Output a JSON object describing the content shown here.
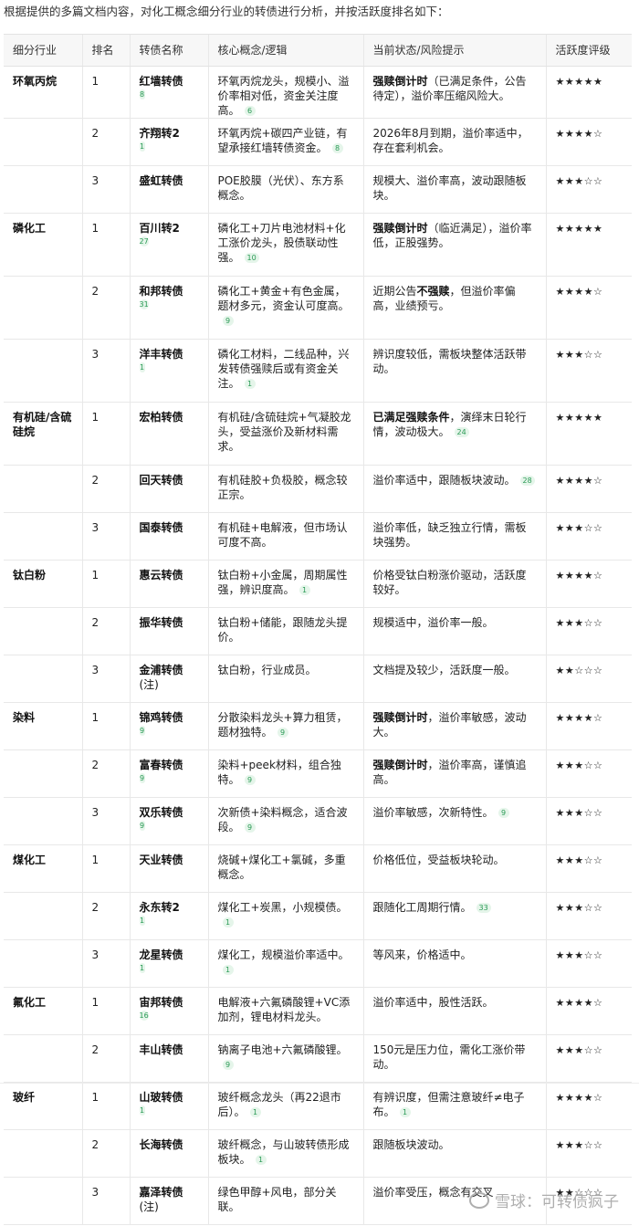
{
  "intro": "根据提供的多篇文档内容，对化工概念细分行业的转债进行分析，并按活跃度排名如下：",
  "headers": [
    "细分行业",
    "排名",
    "转债名称",
    "核心概念/逻辑",
    "当前状态/风险提示",
    "活跃度评级"
  ],
  "rows": [
    {
      "industry": "环氧丙烷",
      "rank": "1",
      "bond": "红墙转债",
      "bond_badge": "8",
      "bond_note": "",
      "concept": "环氧丙烷龙头，规模小、溢价率相对低，资金关注度高。",
      "concept_badge": "6",
      "status_strong": "强赎倒计时",
      "status": "（已满足条件，公告待定），溢价率压缩风险大。",
      "status_strong2": "",
      "status_tail": "",
      "status_badge": "",
      "rating": "★★★★★"
    },
    {
      "industry": "",
      "rank": "2",
      "bond": "齐翔转2",
      "bond_badge": "1",
      "bond_note": "",
      "concept": "环氧丙烷+碳四产业链，有望承接红墙转债资金。",
      "concept_badge": "8",
      "status_strong": "",
      "status": "2026年8月到期，溢价率适中，存在套利机会。",
      "status_strong2": "",
      "status_tail": "",
      "status_badge": "",
      "rating": "★★★★☆"
    },
    {
      "industry": "",
      "rank": "3",
      "bond": "盛虹转债",
      "bond_badge": "",
      "bond_note": "",
      "concept": "POE胶膜（光伏）、东方系概念。",
      "concept_badge": "",
      "status_strong": "",
      "status": "规模大、溢价率高，波动跟随板块。",
      "status_strong2": "",
      "status_tail": "",
      "status_badge": "",
      "rating": "★★★☆☆"
    },
    {
      "industry": "磷化工",
      "rank": "1",
      "bond": "百川转2",
      "bond_badge": "27",
      "bond_note": "",
      "concept": "磷化工+刀片电池材料+化工涨价龙头，股债联动性强。",
      "concept_badge": "10",
      "status_strong": "强赎倒计时",
      "status": "（临近满足），溢价率低，正股强势。",
      "status_strong2": "",
      "status_tail": "",
      "status_badge": "",
      "rating": "★★★★★",
      "tall": true
    },
    {
      "industry": "",
      "rank": "2",
      "bond": "和邦转债",
      "bond_badge": "31",
      "bond_note": "",
      "concept": "磷化工+黄金+有色金属，题材多元，资金认可度高。",
      "concept_badge": "9",
      "status_strong": "",
      "status": "近期公告",
      "status_strong2": "不强赎",
      "status_tail": "，但溢价率偏高，业绩预亏。",
      "status_badge": "",
      "rating": "★★★★☆",
      "tall": true
    },
    {
      "industry": "",
      "rank": "3",
      "bond": "洋丰转债",
      "bond_badge": "1",
      "bond_note": "",
      "concept": "磷化工材料，二线品种，兴发转债强赎后或有资金关注。",
      "concept_badge": "1",
      "status_strong": "",
      "status": "辨识度较低，需板块整体活跃带动。",
      "status_strong2": "",
      "status_tail": "",
      "status_badge": "",
      "rating": "★★★☆☆",
      "tall": true
    },
    {
      "industry": "有机硅/含硫硅烷",
      "rank": "1",
      "bond": "宏柏转债",
      "bond_badge": "",
      "bond_note": "",
      "concept": "有机硅/含硫硅烷+气凝胶龙头，受益涨价及新材料需求。",
      "concept_badge": "",
      "status_strong": "已满足强赎条件",
      "status": "，演绎末日轮行情，波动极大。",
      "status_strong2": "",
      "status_tail": "",
      "status_badge": "24",
      "rating": "★★★★★",
      "tall": true
    },
    {
      "industry": "",
      "rank": "2",
      "bond": "回天转债",
      "bond_badge": "",
      "bond_note": "",
      "concept": "有机硅胶+负极胶，概念较正宗。",
      "concept_badge": "",
      "status_strong": "",
      "status": "溢价率适中，跟随板块波动。",
      "status_strong2": "",
      "status_tail": "",
      "status_badge": "28",
      "rating": "★★★★☆"
    },
    {
      "industry": "",
      "rank": "3",
      "bond": "国泰转债",
      "bond_badge": "",
      "bond_note": "",
      "concept": "有机硅+电解液，但市场认可度不高。",
      "concept_badge": "",
      "status_strong": "",
      "status": "溢价率低，缺乏独立行情，需板块强势。",
      "status_strong2": "",
      "status_tail": "",
      "status_badge": "",
      "rating": "★★★☆☆"
    },
    {
      "industry": "钛白粉",
      "rank": "1",
      "bond": "惠云转债",
      "bond_badge": "",
      "bond_note": "",
      "concept": "钛白粉+小金属，周期属性强，辨识度高。",
      "concept_badge": "1",
      "status_strong": "",
      "status": "价格受钛白粉涨价驱动，活跃度较好。",
      "status_strong2": "",
      "status_tail": "",
      "status_badge": "",
      "rating": "★★★★☆"
    },
    {
      "industry": "",
      "rank": "2",
      "bond": "振华转债",
      "bond_badge": "",
      "bond_note": "",
      "concept": "钛白粉+储能，跟随龙头提价。",
      "concept_badge": "",
      "status_strong": "",
      "status": "规模适中，溢价率一般。",
      "status_strong2": "",
      "status_tail": "",
      "status_badge": "",
      "rating": "★★★☆☆"
    },
    {
      "industry": "",
      "rank": "3",
      "bond": "金浦转债",
      "bond_badge": "",
      "bond_note": "(注)",
      "concept": "钛白粉，行业成员。",
      "concept_badge": "",
      "status_strong": "",
      "status": "文档提及较少，活跃度一般。",
      "status_strong2": "",
      "status_tail": "",
      "status_badge": "",
      "rating": "★★☆☆☆"
    },
    {
      "industry": "染料",
      "rank": "1",
      "bond": "锦鸡转债",
      "bond_badge": "9",
      "bond_note": "",
      "concept": "分散染料龙头+算力租赁，题材独特。",
      "concept_badge": "9",
      "status_strong": "强赎倒计时",
      "status": "，溢价率敏感，波动大。",
      "status_strong2": "",
      "status_tail": "",
      "status_badge": "",
      "rating": "★★★★☆"
    },
    {
      "industry": "",
      "rank": "2",
      "bond": "富春转债",
      "bond_badge": "9",
      "bond_note": "",
      "concept": "染料+peek材料，组合独特。",
      "concept_badge": "9",
      "status_strong": "强赎倒计时",
      "status": "，溢价率高，谨慎追高。",
      "status_strong2": "",
      "status_tail": "",
      "status_badge": "",
      "rating": "★★★☆☆"
    },
    {
      "industry": "",
      "rank": "3",
      "bond": "双乐转债",
      "bond_badge": "9",
      "bond_note": "",
      "concept": "次新债+染料概念，适合波段。",
      "concept_badge": "9",
      "status_strong": "",
      "status": "溢价率敏感，次新特性。",
      "status_strong2": "",
      "status_tail": "",
      "status_badge": "9",
      "rating": "★★★☆☆"
    },
    {
      "industry": "煤化工",
      "rank": "1",
      "bond": "天业转债",
      "bond_badge": "",
      "bond_note": "",
      "concept": "烧碱+煤化工+氯碱，多重概念。",
      "concept_badge": "",
      "status_strong": "",
      "status": "价格低位，受益板块轮动。",
      "status_strong2": "",
      "status_tail": "",
      "status_badge": "",
      "rating": "★★★☆☆"
    },
    {
      "industry": "",
      "rank": "2",
      "bond": "永东转2",
      "bond_badge": "1",
      "bond_note": "",
      "concept": "煤化工+炭黑，小规模债。",
      "concept_badge": "1",
      "status_strong": "",
      "status": "跟随化工周期行情。",
      "status_strong2": "",
      "status_tail": "",
      "status_badge": "33",
      "rating": "★★★☆☆"
    },
    {
      "industry": "",
      "rank": "3",
      "bond": "龙星转债",
      "bond_badge": "1",
      "bond_note": "",
      "concept": "煤化工，规模溢价率适中。",
      "concept_badge": "1",
      "status_strong": "",
      "status": "等风来，价格适中。",
      "status_strong2": "",
      "status_tail": "",
      "status_badge": "",
      "rating": "★★★☆☆"
    },
    {
      "industry": "氟化工",
      "rank": "1",
      "bond": "宙邦转债",
      "bond_badge": "16",
      "bond_note": "",
      "concept": "电解液+六氟磷酸锂+VC添加剂，锂电材料龙头。",
      "concept_badge": "",
      "status_strong": "",
      "status": "溢价率适中，股性活跃。",
      "status_strong2": "",
      "status_tail": "",
      "status_badge": "",
      "rating": "★★★★☆"
    },
    {
      "industry": "",
      "rank": "2",
      "bond": "丰山转债",
      "bond_badge": "",
      "bond_note": "",
      "concept": "钠离子电池+六氟磷酸锂。",
      "concept_badge": "9",
      "status_strong": "",
      "status": "150元是压力位，需化工涨价带动。",
      "status_strong2": "",
      "status_tail": "",
      "status_badge": "",
      "rating": "★★★☆☆"
    },
    {
      "industry": "玻纤",
      "rank": "1",
      "bond": "山玻转债",
      "bond_badge": "1",
      "bond_note": "",
      "concept": "玻纤概念龙头（再22退市后）。",
      "concept_badge": "1",
      "status_strong": "",
      "status": "有辨识度，但需注意玻纤≠电子布。",
      "status_strong2": "",
      "status_tail": "",
      "status_badge": "1",
      "rating": "★★★★☆"
    },
    {
      "industry": "",
      "rank": "2",
      "bond": "长海转债",
      "bond_badge": "",
      "bond_note": "",
      "concept": "玻纤概念，与山玻转债形成板块。",
      "concept_badge": "1",
      "status_strong": "",
      "status": "跟随板块波动。",
      "status_strong2": "",
      "status_tail": "",
      "status_badge": "",
      "rating": "★★★☆☆"
    },
    {
      "industry": "",
      "rank": "3",
      "bond": "嘉泽转债",
      "bond_badge": "",
      "bond_note": "(注)",
      "concept": "绿色甲醇+风电，部分关联。",
      "concept_badge": "",
      "status_strong": "",
      "status": "溢价率受压，概念有交叉",
      "status_strong2": "",
      "status_tail": "",
      "status_badge": "",
      "rating": "★★☆☆☆"
    }
  ],
  "watermark": "雪球：可转债疯子"
}
